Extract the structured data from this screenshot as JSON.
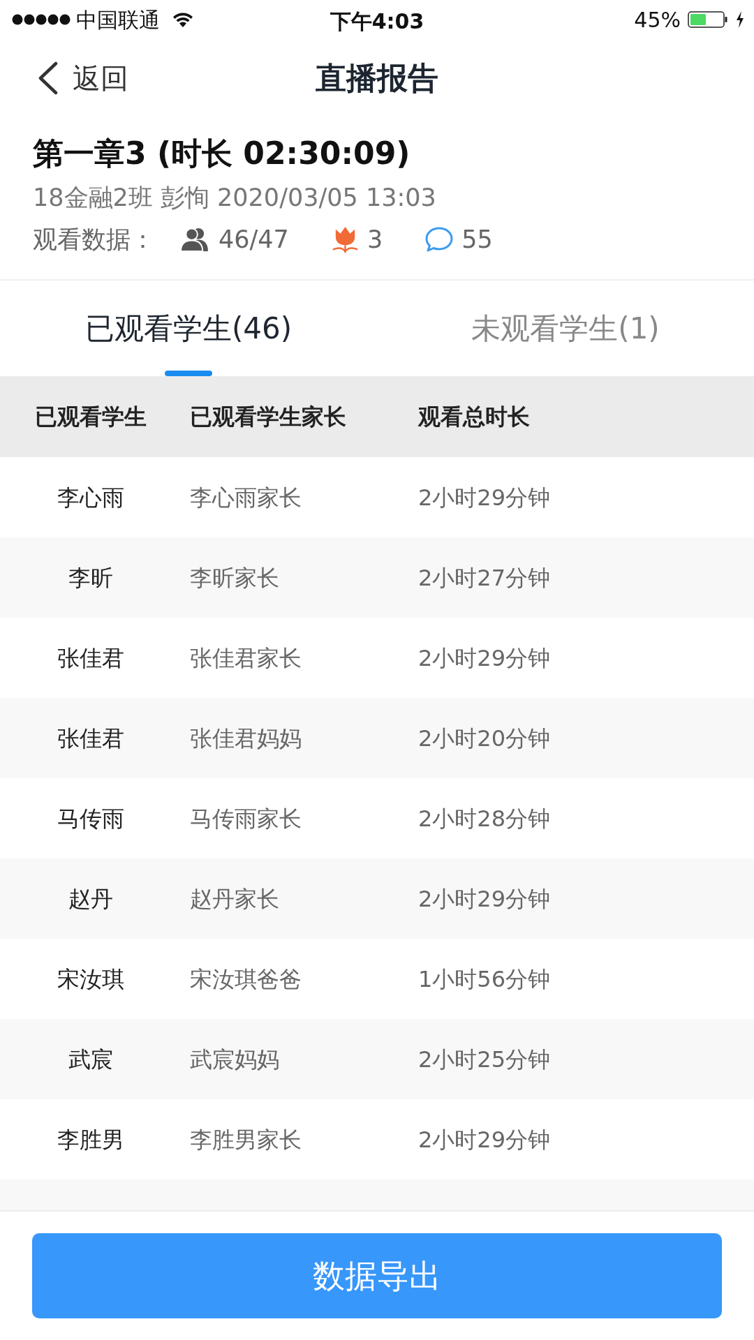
{
  "status_bar": {
    "carrier": "中国联通",
    "time": "下午4:03",
    "battery": "45%"
  },
  "nav": {
    "back": "返回",
    "title": "直播报告"
  },
  "summary": {
    "title": "第一章3 (时长 02:30:09)",
    "subtitle": "18金融2班 彭恂 2020/03/05 13:03",
    "stats_label": "观看数据：",
    "stats": [
      {
        "kind": "viewers",
        "value": "46/47"
      },
      {
        "kind": "flowers",
        "value": "3"
      },
      {
        "kind": "comments",
        "value": "55"
      }
    ]
  },
  "tabs": [
    {
      "label": "已观看学生(46)",
      "selected": true
    },
    {
      "label": "未观看学生(1)",
      "selected": false
    }
  ],
  "table": {
    "columns": [
      "已观看学生",
      "已观看学生家长",
      "观看总时长"
    ],
    "rows": [
      [
        "李心雨",
        "李心雨家长",
        "2小时29分钟"
      ],
      [
        "李昕",
        "李昕家长",
        "2小时27分钟"
      ],
      [
        "张佳君",
        "张佳君家长",
        "2小时29分钟"
      ],
      [
        "张佳君",
        "张佳君妈妈",
        "2小时20分钟"
      ],
      [
        "马传雨",
        "马传雨家长",
        "2小时28分钟"
      ],
      [
        "赵丹",
        "赵丹家长",
        "2小时29分钟"
      ],
      [
        "宋汝琪",
        "宋汝琪爸爸",
        "1小时56分钟"
      ],
      [
        "武宸",
        "武宸妈妈",
        "2小时25分钟"
      ],
      [
        "李胜男",
        "李胜男家长",
        "2小时29分钟"
      ]
    ]
  },
  "export_button": "数据导出"
}
